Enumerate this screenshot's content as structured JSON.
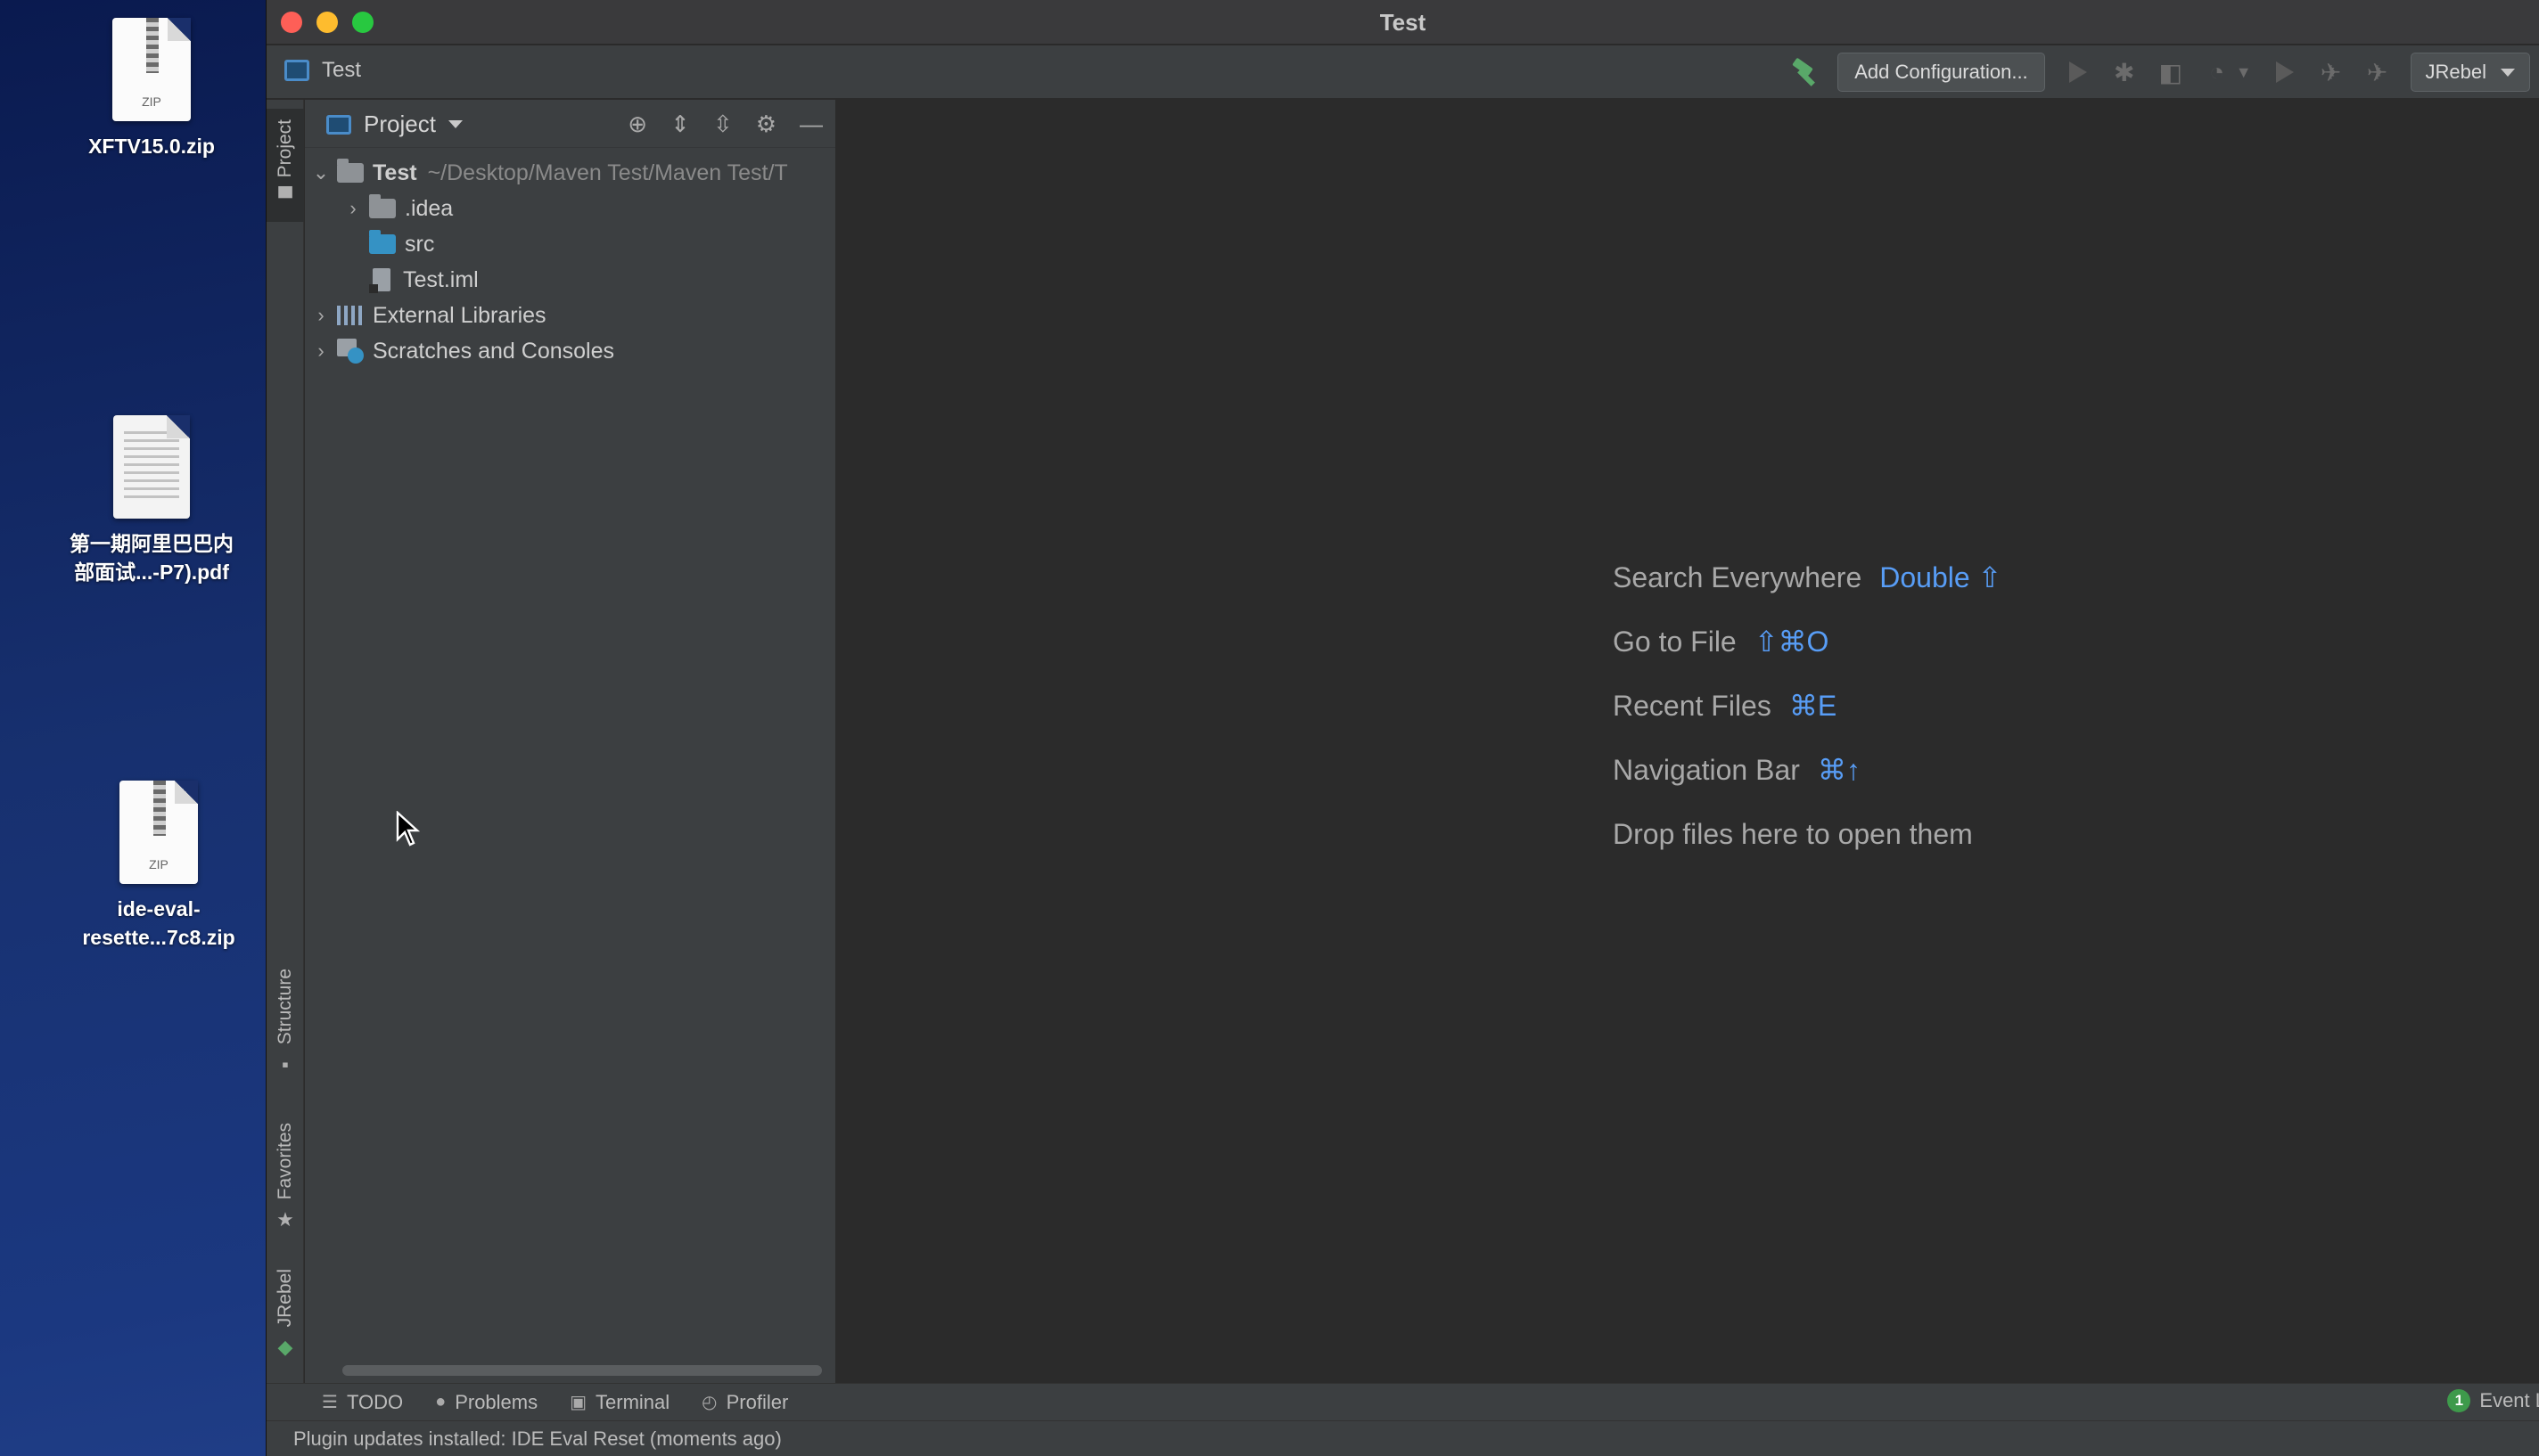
{
  "desktop": {
    "icons": [
      {
        "label": "XFTV15.0.zip",
        "tag": "ZIP"
      },
      {
        "label_line1": "第一期阿里巴巴内",
        "label_line2": "部面试...-P7).pdf"
      },
      {
        "label_line1": "ide-eval-",
        "label_line2": "resette...7c8.zip",
        "tag": "ZIP"
      }
    ]
  },
  "window": {
    "title": "Test",
    "breadcrumb": "Test",
    "toolbar": {
      "add_configuration": "Add Configuration...",
      "jrebel": "JRebel"
    }
  },
  "left_strip": {
    "project": "Project",
    "structure": "Structure",
    "favorites": "Favorites",
    "jrebel": "JRebel"
  },
  "project_panel": {
    "title": "Project",
    "tree": [
      {
        "name": "Test",
        "path": "~/Desktop/Maven Test/Maven Test/T"
      },
      {
        "name": ".idea"
      },
      {
        "name": "src"
      },
      {
        "name": "Test.iml"
      },
      {
        "name": "External Libraries"
      },
      {
        "name": "Scratches and Consoles"
      }
    ]
  },
  "editor": {
    "hints": [
      {
        "label": "Search Everywhere",
        "key": "Double ⇧"
      },
      {
        "label": "Go to File",
        "key": "⇧⌘O"
      },
      {
        "label": "Recent Files",
        "key": "⌘E"
      },
      {
        "label": "Navigation Bar",
        "key": "⌘↑"
      },
      {
        "label": "Drop files here to open them",
        "key": ""
      }
    ]
  },
  "bottom_bar": {
    "tabs": [
      "TODO",
      "Problems",
      "Terminal",
      "Profiler"
    ],
    "event_log_count": "1",
    "event_log": "Event L"
  },
  "status": {
    "message": "Plugin updates installed: IDE Eval Reset (moments ago)"
  },
  "colors": {
    "accent_blue": "#589df6",
    "panel_bg": "#3c3f41",
    "editor_bg": "#2b2b2b",
    "green": "#59a869"
  }
}
